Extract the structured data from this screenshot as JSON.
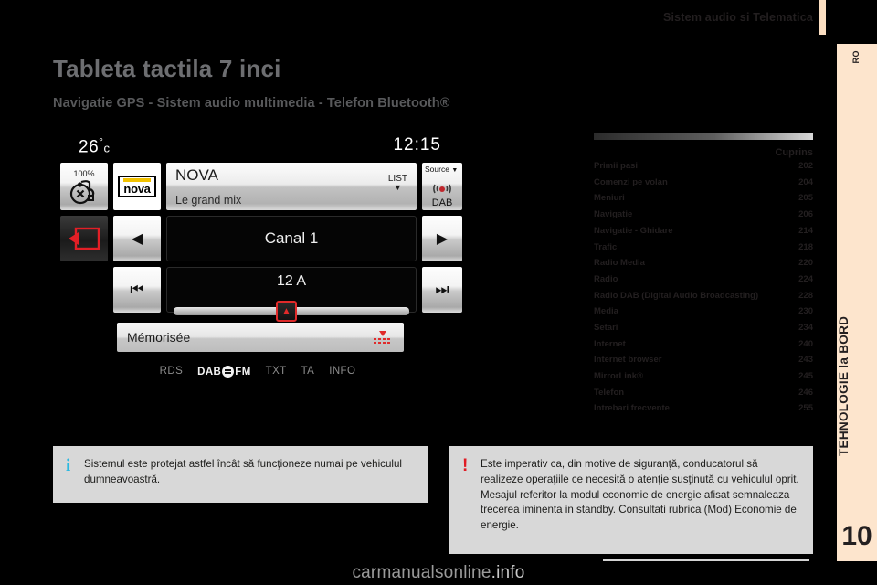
{
  "header": {
    "title": "Sistem audio si Telematica"
  },
  "sidebar": {
    "label": "TEHNOLOGIE la BORD",
    "chapter_number": "10",
    "chapter_code": "RO"
  },
  "titles": {
    "main": "Tableta tactila 7 inci",
    "sub": "Navigatie GPS - Sistem audio multimedia - Telefon Bluetooth®"
  },
  "screen": {
    "temperature": "26",
    "temp_unit": "c",
    "clock": "12:15",
    "volume_pct": "100%",
    "station_logo": "nova",
    "station_name": "NOVA",
    "station_sub": "Le grand mix",
    "list_label": "LIST",
    "source_label": "Source",
    "source_value": "DAB",
    "channel": "Canal 1",
    "frequency": "12 A",
    "memorised": "Mémorisée",
    "tags": [
      "RDS",
      "DAB",
      "FM",
      "TXT",
      "TA",
      "INFO"
    ]
  },
  "toc": {
    "heading": "Cuprins",
    "rows": [
      {
        "label": "Primii pasi",
        "page": "202"
      },
      {
        "label": "Comenzi pe volan",
        "page": "204"
      },
      {
        "label": "Meniuri",
        "page": "205"
      },
      {
        "label": "Navigatie",
        "page": "206"
      },
      {
        "label": "Navigatie - Ghidare",
        "page": "214"
      },
      {
        "label": "Trafic",
        "page": "218"
      },
      {
        "label": "Radio Media",
        "page": "220"
      },
      {
        "label": "Radio",
        "page": "224"
      },
      {
        "label": "Radio DAB (Digital Audio Broadcasting)",
        "page": "228"
      },
      {
        "label": "Media",
        "page": "230"
      },
      {
        "label": "Setari",
        "page": "234"
      },
      {
        "label": "Internet",
        "page": "240"
      },
      {
        "label": "Internet browser",
        "page": "243"
      },
      {
        "label": "MirrorLink®",
        "page": "245"
      },
      {
        "label": "Telefon",
        "page": "246"
      },
      {
        "label": "Intrebari frecvente",
        "page": "255"
      }
    ]
  },
  "notes": {
    "info": {
      "icon": "i",
      "text": "Sistemul este protejat astfel încât să funcţioneze numai pe vehiculul dumneavoastră."
    },
    "warning": {
      "icon": "!",
      "paragraph1": "Este imperativ ca, din motive de siguranţă, conducatorul să realizeze operaţiile ce necesită o atenţie susţinută cu vehiculul oprit.",
      "paragraph2": "Mesajul referitor la modul economie de energie afisat semnaleaza trecerea iminenta in standby. Consultati rubrica (Mod) Economie de energie."
    }
  },
  "watermark": {
    "text_main": "carmanualsonline",
    "text_tld": ".info"
  },
  "colors": {
    "sidebar_bg": "#fde5cd",
    "note_bg": "#d8d8d8",
    "info_icon": "#2bb8e0",
    "warn_icon": "#e01b24",
    "title": "#6d6e71"
  }
}
